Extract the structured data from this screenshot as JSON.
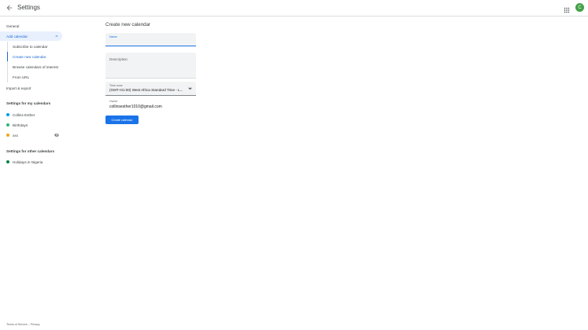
{
  "header": {
    "title": "Settings",
    "avatar_initial": "C"
  },
  "sidebar": {
    "general": "General",
    "add_calendar": "Add calendar",
    "sub_items": [
      {
        "label": "Subscribe to calendar"
      },
      {
        "label": "Create new calendar"
      },
      {
        "label": "Browse calendars of interest"
      },
      {
        "label": "From URL"
      }
    ],
    "import_export": "Import & export",
    "my_calendars_title": "Settings for my calendars",
    "my_calendars": [
      {
        "label": "Collins Esther",
        "color": "#039be5"
      },
      {
        "label": "Birthdays",
        "color": "#33b679"
      },
      {
        "label": "xxx",
        "color": "#f6a21d"
      }
    ],
    "other_calendars_title": "Settings for other calendars",
    "other_calendars": [
      {
        "label": "Holidays in Nigeria",
        "color": "#0b8043"
      }
    ]
  },
  "main": {
    "title": "Create new calendar",
    "name_label": "Name",
    "name_value": "",
    "description_label": "Description",
    "description_value": "",
    "timezone_label": "Time zone",
    "timezone_value": "(GMT+01:00) West Africa Standard Time - L...",
    "owner_label": "Owner",
    "owner_value": "collinsesther1010@gmail.com",
    "create_button": "Create calendar"
  },
  "footer": {
    "terms": "Terms of Service",
    "separator": "–",
    "privacy": "Privacy"
  },
  "colors": {
    "accent": "#1a73e8",
    "selected_bg": "#e8f0fe",
    "avatar": "#43a047"
  }
}
